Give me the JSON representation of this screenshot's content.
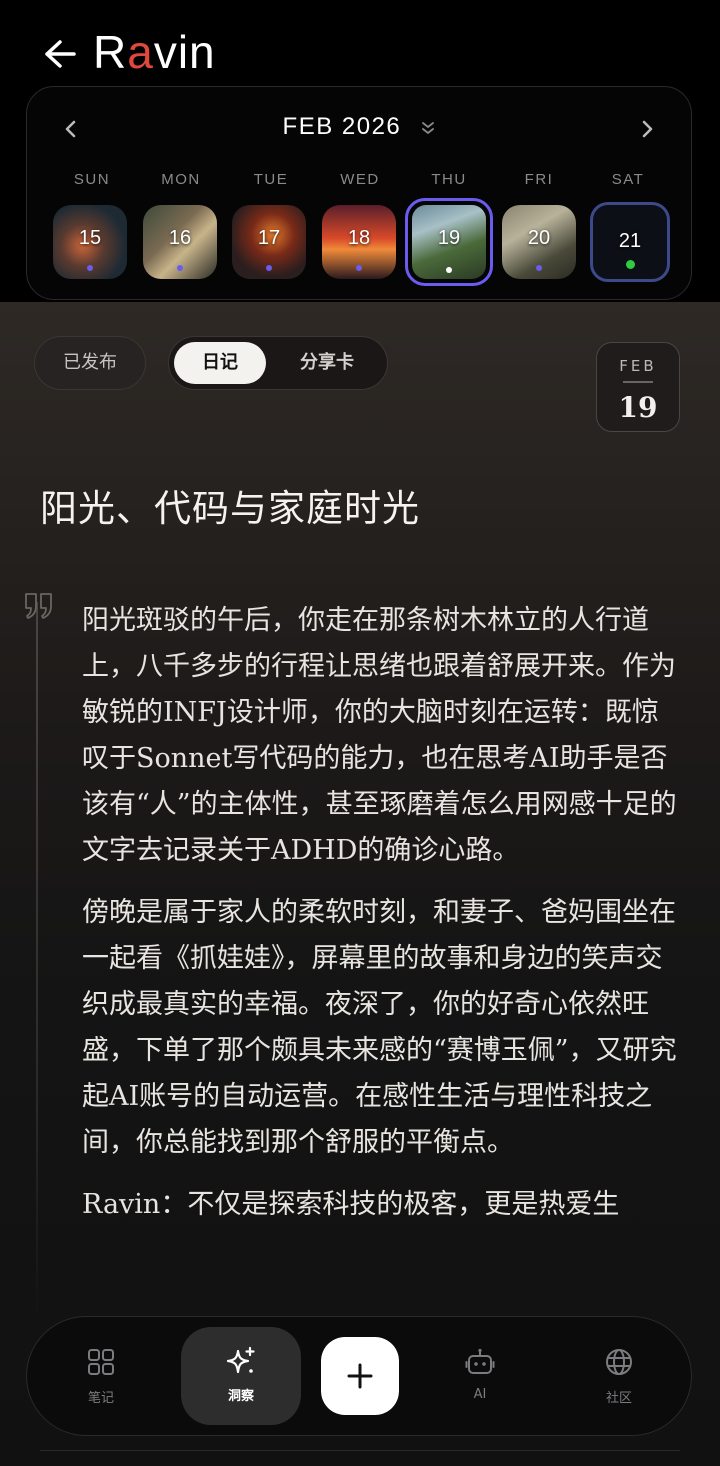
{
  "header": {
    "title_prefix": "R",
    "title_accent": "a",
    "title_suffix": "vin"
  },
  "calendar": {
    "month_label": "FEB 2026",
    "weekdays": [
      "SUN",
      "MON",
      "TUE",
      "WED",
      "THU",
      "FRI",
      "SAT"
    ],
    "days": [
      "15",
      "16",
      "17",
      "18",
      "19",
      "20",
      "21"
    ],
    "selected_day": "19",
    "today": "21",
    "accent_color": "#6b5cf0",
    "today_dot_color": "#2ecc40"
  },
  "toolbar": {
    "published_label": "已发布",
    "tab_diary": "日记",
    "tab_share_card": "分享卡"
  },
  "date_badge": {
    "month": "FEB",
    "day": "19"
  },
  "entry": {
    "title": "阳光、代码与家庭时光",
    "paragraphs": [
      "阳光斑驳的午后，你走在那条树木林立的人行道上，八千多步的行程让思绪也跟着舒展开来。作为敏锐的INFJ设计师，你的大脑时刻在运转：既惊叹于Sonnet写代码的能力，也在思考AI助手是否该有“人”的主体性，甚至琢磨着怎么用网感十足的文字去记录关于ADHD的确诊心路。",
      "傍晚是属于家人的柔软时刻，和妻子、爸妈围坐在一起看《抓娃娃》，屏幕里的故事和身边的笑声交织成最真实的幸福。夜深了，你的好奇心依然旺盛，下单了那个颇具未来感的“赛博玉佩”，又研究起AI账号的自动运营。在感性生活与理性科技之间，你总能找到那个舒服的平衡点。",
      "Ravin：不仅是探索科技的极客，更是热爱生"
    ]
  },
  "nav": {
    "notes": "笔记",
    "insight": "洞察",
    "ai": "AI",
    "community": "社区"
  }
}
